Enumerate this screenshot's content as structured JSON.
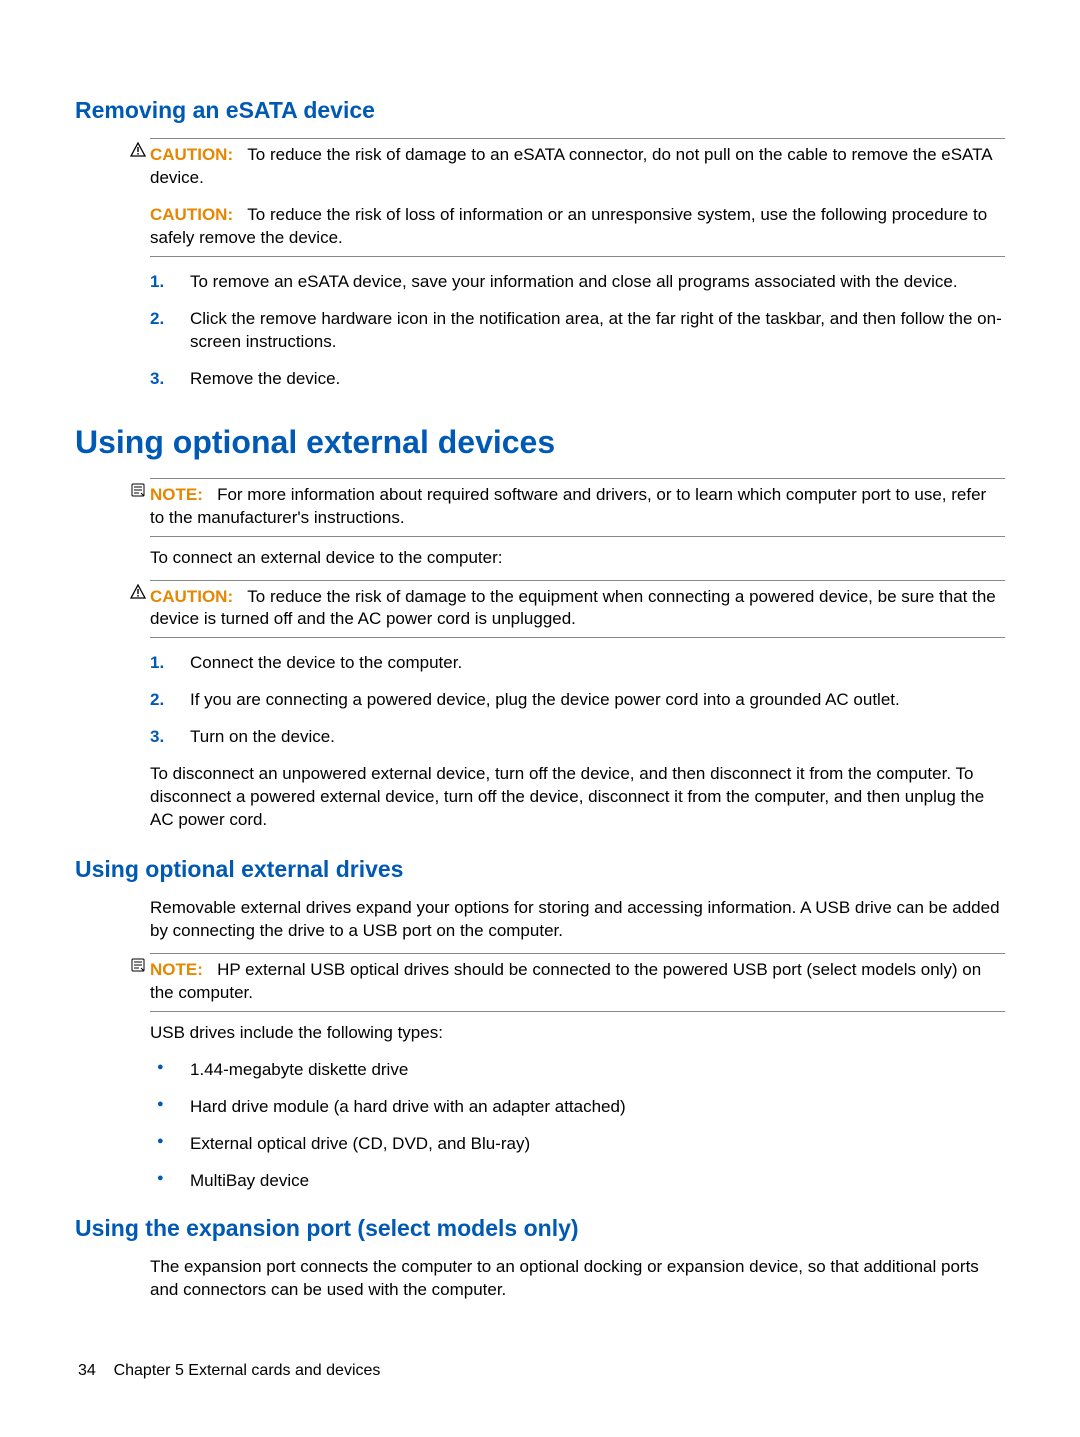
{
  "sections": {
    "removing": {
      "title": "Removing an eSATA device",
      "caution1_label": "CAUTION:",
      "caution1_p1": "To reduce the risk of damage to an eSATA connector, do not pull on the cable to remove the eSATA device.",
      "caution1_p2_label": "CAUTION:",
      "caution1_p2": "To reduce the risk of loss of information or an unresponsive system, use the following procedure to safely remove the device.",
      "steps": [
        "To remove an eSATA device, save your information and close all programs associated with the device.",
        "Click the remove hardware icon in the notification area, at the far right of the taskbar, and then follow the on-screen instructions.",
        "Remove the device."
      ]
    },
    "external_devices": {
      "title": "Using optional external devices",
      "note_label": "NOTE:",
      "note_text": "For more information about required software and drivers, or to learn which computer port to use, refer to the manufacturer's instructions.",
      "intro": "To connect an external device to the computer:",
      "caution_label": "CAUTION:",
      "caution_text": "To reduce the risk of damage to the equipment when connecting a powered device, be sure that the device is turned off and the AC power cord is unplugged.",
      "steps": [
        "Connect the device to the computer.",
        "If you are connecting a powered device, plug the device power cord into a grounded AC outlet.",
        "Turn on the device."
      ],
      "outro": "To disconnect an unpowered external device, turn off the device, and then disconnect it from the computer. To disconnect a powered external device, turn off the device, disconnect it from the computer, and then unplug the AC power cord."
    },
    "external_drives": {
      "title": "Using optional external drives",
      "intro": "Removable external drives expand your options for storing and accessing information. A USB drive can be added by connecting the drive to a USB port on the computer.",
      "note_label": "NOTE:",
      "note_text": "HP external USB optical drives should be connected to the powered USB port (select models only) on the computer.",
      "list_intro": "USB drives include the following types:",
      "bullets": [
        "1.44-megabyte diskette drive",
        "Hard drive module (a hard drive with an adapter attached)",
        "External optical drive (CD, DVD, and Blu-ray)",
        "MultiBay device"
      ]
    },
    "expansion_port": {
      "title": "Using the expansion port (select models only)",
      "text": "The expansion port connects the computer to an optional docking or expansion device, so that additional ports and connectors can be used with the computer."
    }
  },
  "footer": {
    "page_number": "34",
    "chapter": "Chapter 5   External cards and devices"
  }
}
